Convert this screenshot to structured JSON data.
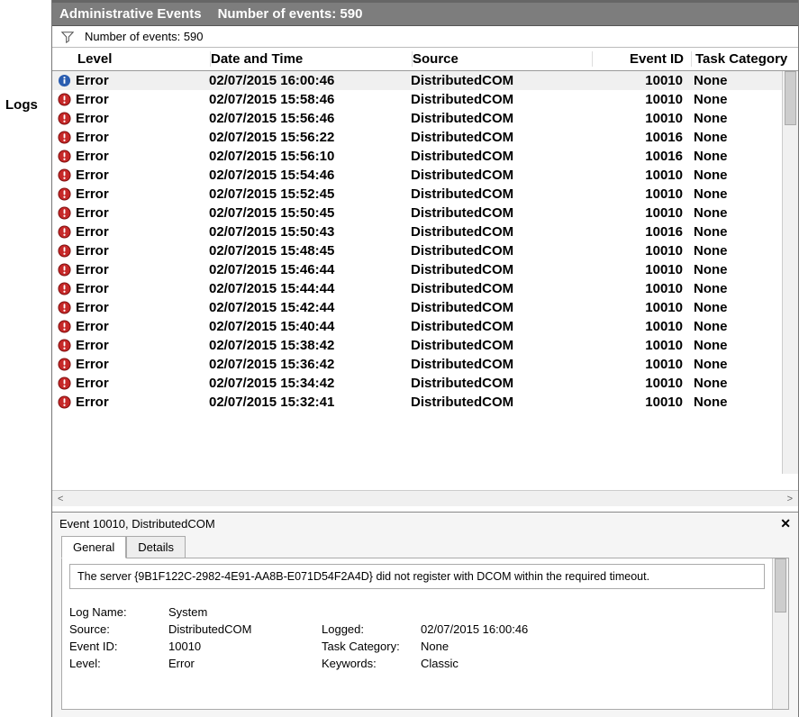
{
  "left": {
    "logs_label": "Logs"
  },
  "header": {
    "title": "Administrative Events",
    "count_label": "Number of events: 590"
  },
  "filter": {
    "count_label": "Number of events: 590"
  },
  "columns": {
    "level": "Level",
    "date": "Date and Time",
    "source": "Source",
    "event_id": "Event ID",
    "task_category": "Task Category"
  },
  "events": [
    {
      "level": "Error",
      "date": "02/07/2015 16:00:46",
      "source": "DistributedCOM",
      "id": "10010",
      "task": "None",
      "selected": true,
      "info_icon": true
    },
    {
      "level": "Error",
      "date": "02/07/2015 15:58:46",
      "source": "DistributedCOM",
      "id": "10010",
      "task": "None"
    },
    {
      "level": "Error",
      "date": "02/07/2015 15:56:46",
      "source": "DistributedCOM",
      "id": "10010",
      "task": "None"
    },
    {
      "level": "Error",
      "date": "02/07/2015 15:56:22",
      "source": "DistributedCOM",
      "id": "10016",
      "task": "None"
    },
    {
      "level": "Error",
      "date": "02/07/2015 15:56:10",
      "source": "DistributedCOM",
      "id": "10016",
      "task": "None"
    },
    {
      "level": "Error",
      "date": "02/07/2015 15:54:46",
      "source": "DistributedCOM",
      "id": "10010",
      "task": "None"
    },
    {
      "level": "Error",
      "date": "02/07/2015 15:52:45",
      "source": "DistributedCOM",
      "id": "10010",
      "task": "None"
    },
    {
      "level": "Error",
      "date": "02/07/2015 15:50:45",
      "source": "DistributedCOM",
      "id": "10010",
      "task": "None"
    },
    {
      "level": "Error",
      "date": "02/07/2015 15:50:43",
      "source": "DistributedCOM",
      "id": "10016",
      "task": "None"
    },
    {
      "level": "Error",
      "date": "02/07/2015 15:48:45",
      "source": "DistributedCOM",
      "id": "10010",
      "task": "None"
    },
    {
      "level": "Error",
      "date": "02/07/2015 15:46:44",
      "source": "DistributedCOM",
      "id": "10010",
      "task": "None"
    },
    {
      "level": "Error",
      "date": "02/07/2015 15:44:44",
      "source": "DistributedCOM",
      "id": "10010",
      "task": "None"
    },
    {
      "level": "Error",
      "date": "02/07/2015 15:42:44",
      "source": "DistributedCOM",
      "id": "10010",
      "task": "None"
    },
    {
      "level": "Error",
      "date": "02/07/2015 15:40:44",
      "source": "DistributedCOM",
      "id": "10010",
      "task": "None"
    },
    {
      "level": "Error",
      "date": "02/07/2015 15:38:42",
      "source": "DistributedCOM",
      "id": "10010",
      "task": "None"
    },
    {
      "level": "Error",
      "date": "02/07/2015 15:36:42",
      "source": "DistributedCOM",
      "id": "10010",
      "task": "None"
    },
    {
      "level": "Error",
      "date": "02/07/2015 15:34:42",
      "source": "DistributedCOM",
      "id": "10010",
      "task": "None"
    },
    {
      "level": "Error",
      "date": "02/07/2015 15:32:41",
      "source": "DistributedCOM",
      "id": "10010",
      "task": "None"
    }
  ],
  "detail": {
    "title": "Event 10010, DistributedCOM",
    "tabs": {
      "general": "General",
      "details": "Details"
    },
    "message": "The server {9B1F122C-2982-4E91-AA8B-E071D54F2A4D} did not register with DCOM within the required timeout.",
    "fields": {
      "log_name_label": "Log Name:",
      "log_name": "System",
      "source_label": "Source:",
      "source": "DistributedCOM",
      "logged_label": "Logged:",
      "logged": "02/07/2015 16:00:46",
      "event_id_label": "Event ID:",
      "event_id": "10010",
      "task_cat_label": "Task Category:",
      "task_cat": "None",
      "level_label": "Level:",
      "level": "Error",
      "keywords_label": "Keywords:",
      "keywords": "Classic"
    }
  }
}
